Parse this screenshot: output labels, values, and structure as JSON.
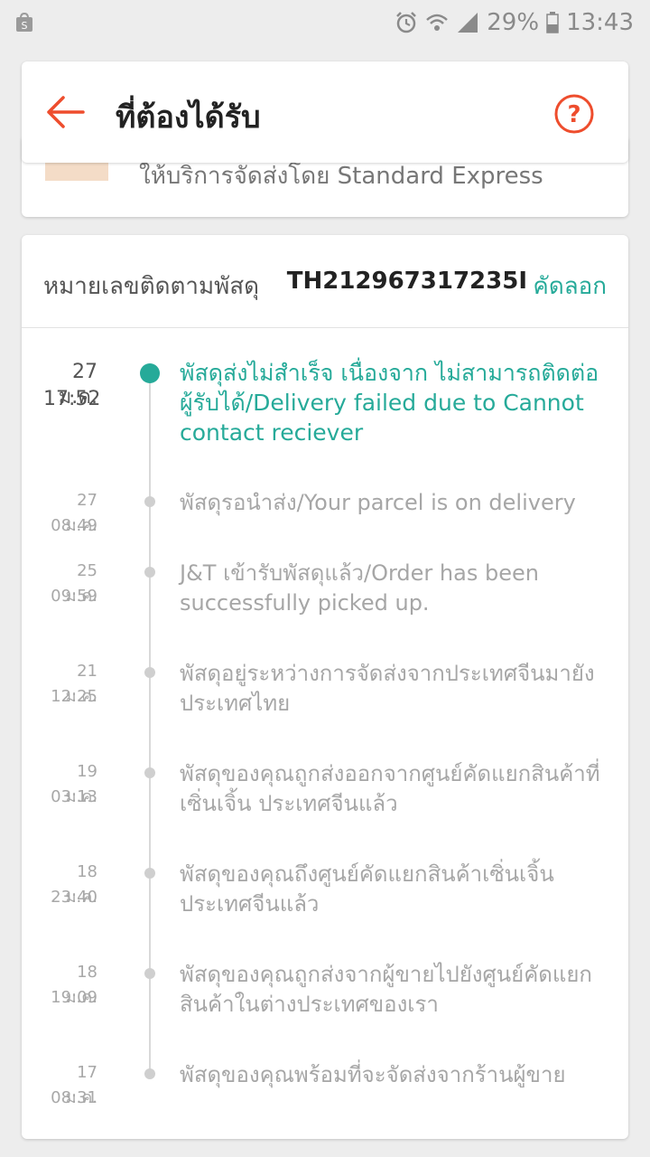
{
  "status_bar": {
    "battery": "29%",
    "time": "13:43",
    "icons": [
      "shopee-bag-icon",
      "alarm-icon",
      "wifi-icon",
      "signal-icon",
      "battery-icon"
    ]
  },
  "header": {
    "title": "ที่ต้องได้รับ",
    "back_icon": "back-arrow-icon",
    "help_icon": "help-icon"
  },
  "product": {
    "shipping_text": "ให้บริการจัดส่งโดย Standard Express"
  },
  "tracking": {
    "label": "หมายเลขติดตามพัสดุ",
    "number": "TH212967317235I",
    "copy_label": "คัดลอก",
    "events": [
      {
        "date": "27 ม.ค.",
        "time": "17:52",
        "text": "พัสดุส่งไม่สำเร็จ เนื่องจาก ไม่สามารถติดต่อผู้รับได้/Delivery failed due to Cannot contact reciever",
        "active": true
      },
      {
        "date": "27 ม.ค.",
        "time": "08:49",
        "text": "พัสดุรอนำส่ง/Your parcel is on delivery"
      },
      {
        "date": "25 ม.ค.",
        "time": "09:59",
        "text": "J&T เข้ารับพัสดุแล้ว/Order has been successfully picked up."
      },
      {
        "date": "21 ม.ค.",
        "time": "12:25",
        "text": "พัสดุอยู่ระหว่างการจัดส่งจากประเทศจีนมายังประเทศไทย"
      },
      {
        "date": "19 ม.ค.",
        "time": "03:13",
        "text": "พัสดุของคุณถูกส่งออกจากศูนย์คัดแยกสินค้าที่เซิ่นเจิ้น ประเทศจีนแล้ว"
      },
      {
        "date": "18 ม.ค.",
        "time": "23:40",
        "text": "พัสดุของคุณถึงศูนย์คัดแยกสินค้าเซิ่นเจิ้นประเทศจีนแล้ว"
      },
      {
        "date": "18 ม.ค.",
        "time": "19:09",
        "text": "พัสดุของคุณถูกส่งจากผู้ขายไปยังศูนย์คัดแยกสินค้าในต่างประเทศของเรา"
      },
      {
        "date": "17 ม.ค.",
        "time": "08:31",
        "text": "พัสดุของคุณพร้อมที่จะจัดส่งจากร้านผู้ขาย"
      }
    ]
  },
  "colors": {
    "accent": "#26aa99",
    "back_arrow": "#ee4d2d",
    "muted_text": "#a6a6a6",
    "background": "#ededed"
  }
}
